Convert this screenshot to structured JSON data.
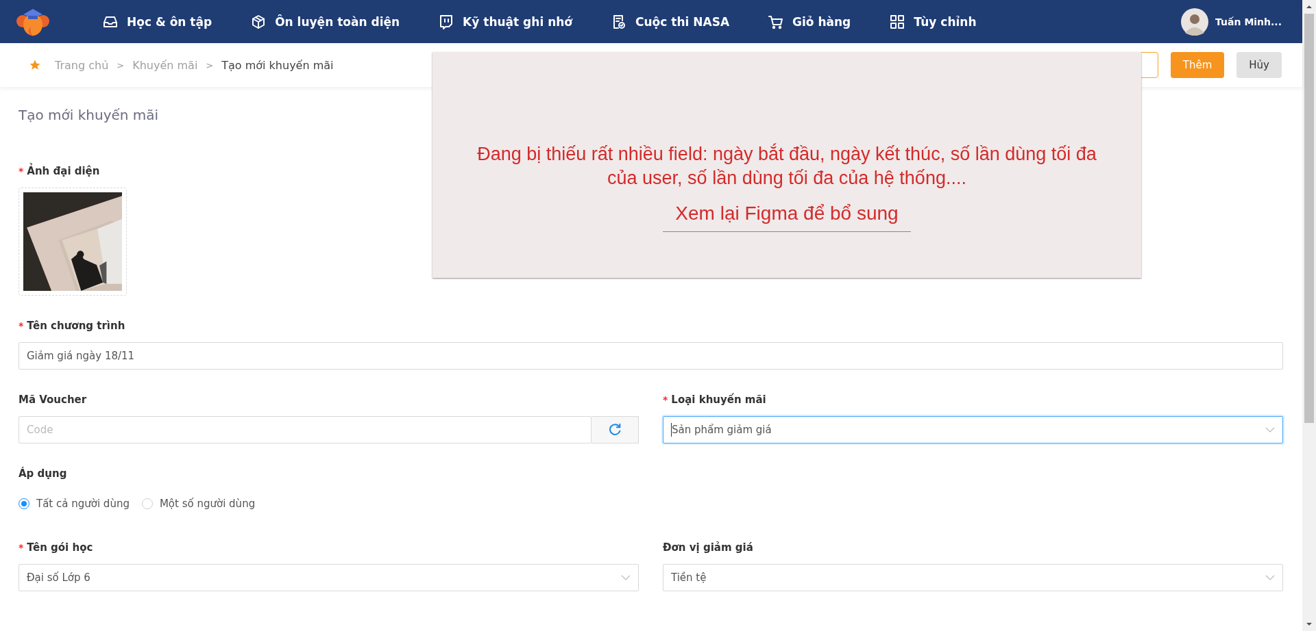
{
  "nav": {
    "items": [
      {
        "label": "Học & ôn tập"
      },
      {
        "label": "Ôn luyện toàn diện"
      },
      {
        "label": "Kỹ thuật ghi nhớ"
      },
      {
        "label": "Cuộc thi NASA"
      },
      {
        "label": "Giỏ hàng"
      },
      {
        "label": "Tùy chỉnh"
      }
    ],
    "user": {
      "name": "Tuấn Minh..."
    }
  },
  "breadcrumb": [
    {
      "label": "Trang chủ",
      "current": false,
      "separator": ">"
    },
    {
      "label": "Khuyến mãi",
      "current": false,
      "separator": ">"
    },
    {
      "label": "Tạo mới khuyến mãi",
      "current": true
    }
  ],
  "actions": [
    {
      "label": "Thêm",
      "kind": "primary"
    },
    {
      "label": "Hủy",
      "kind": "secondary"
    }
  ],
  "form": {
    "title": "Tạo mới khuyến mãi",
    "rows": [
      [
        {
          "kind": "upload",
          "label": "Ảnh đại diện",
          "required_mark": "*"
        }
      ],
      [
        {
          "kind": "text",
          "label": "Tên chương trình",
          "required_mark": "*",
          "value": "Giảm giá ngày 18/11"
        }
      ],
      [
        {
          "kind": "code",
          "label": "Mã Voucher",
          "placeholder": "Code"
        },
        {
          "kind": "select",
          "label": "Loại khuyến mãi",
          "required_mark": "*",
          "value": "Sản phẩm giảm giá",
          "focused": true
        }
      ],
      [
        {
          "kind": "radio",
          "label": "Áp dụng",
          "options": [
            {
              "label": "Tất cả người dùng",
              "selected": true
            },
            {
              "label": "Một số người dùng",
              "selected": false
            }
          ]
        }
      ],
      [
        {
          "kind": "select",
          "label": "Tên gói học",
          "required_mark": "*",
          "value": "Đại số Lớp 6",
          "focused": false
        },
        {
          "kind": "select",
          "label": "Đơn vị giảm giá",
          "value": "Tiền tệ",
          "focused": false
        }
      ]
    ]
  },
  "notice": {
    "message": "Đang bị thiếu rất nhiều field: ngày bắt đầu, ngày kết thúc, số lần dùng tối đa của user, số lần dùng tối đa của hệ thống....",
    "link": "Xem lại Figma để bổ sung"
  }
}
